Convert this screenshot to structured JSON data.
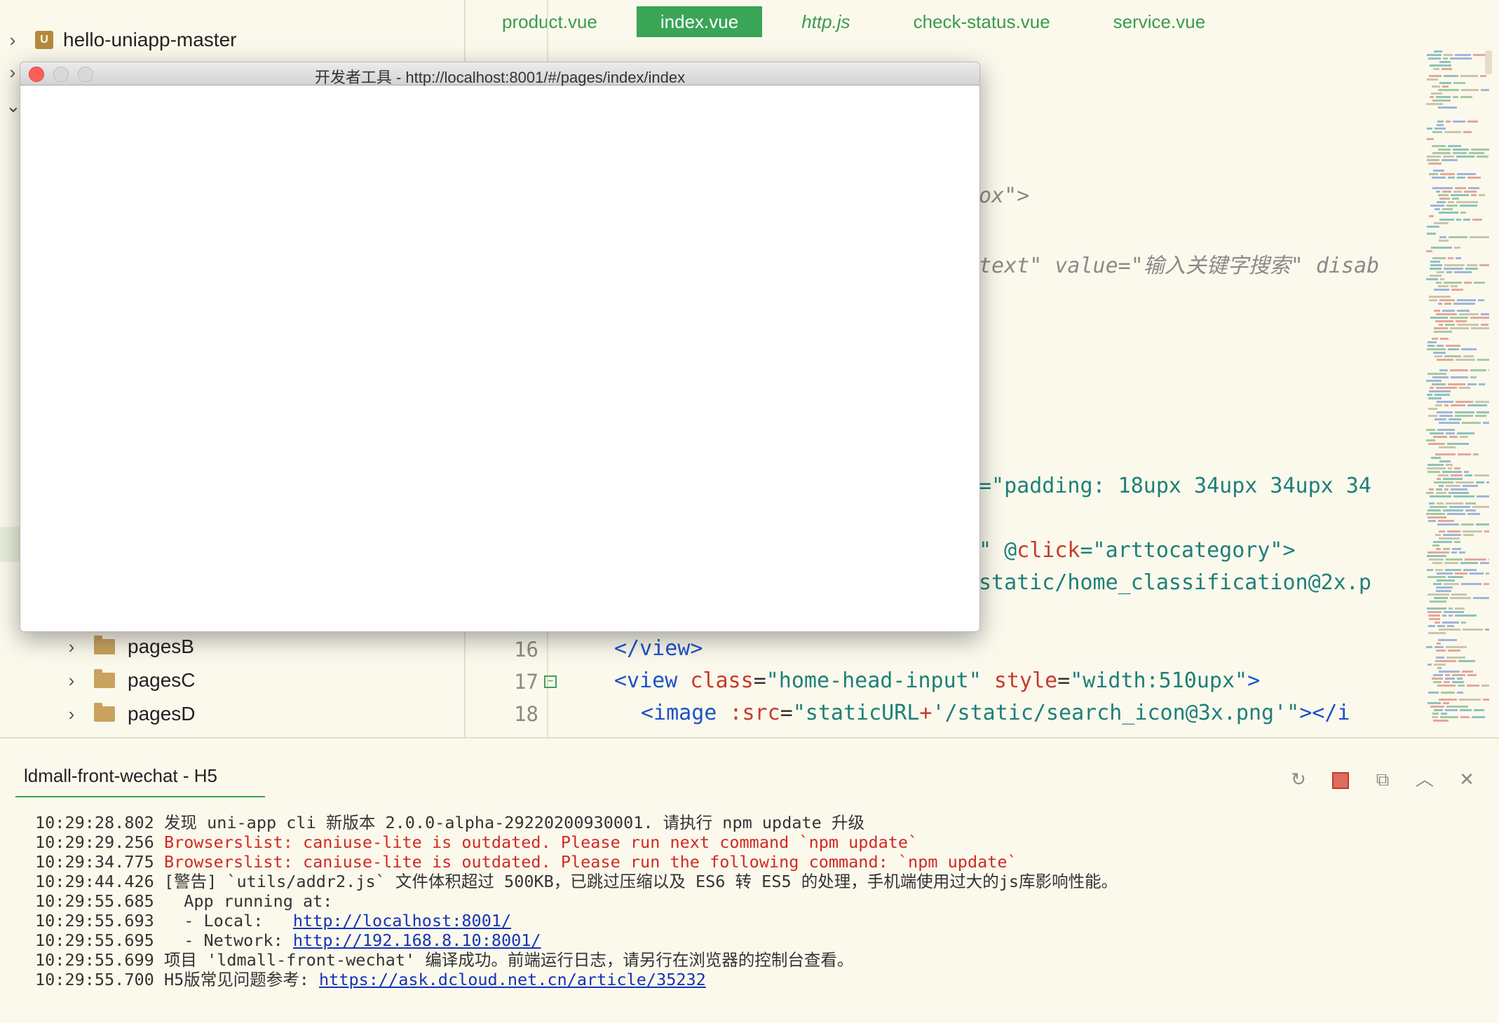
{
  "sidebar": {
    "project": "hello-uniapp-master",
    "folders": [
      "pagesB",
      "pagesC",
      "pagesD"
    ]
  },
  "editor": {
    "tabs": [
      {
        "label": "product.vue"
      },
      {
        "label": "index.vue"
      },
      {
        "label": "http.js"
      },
      {
        "label": "check-status.vue"
      },
      {
        "label": "service.vue"
      }
    ],
    "fragments": {
      "f1": "ox\">",
      "f2a": "text\" value=\"输入关键字搜索\" disab",
      "f3": "=\"padding: 18upx 34upx 34upx 34",
      "f4a": "\" @",
      "f4b": "click",
      "f4c": "=\"arttocategory\">",
      "f5": "static/home_classification@2x.p"
    },
    "lines": {
      "n16": "16",
      "n17": "17",
      "n18": "18",
      "l16": "</view>",
      "l17_tag": "<view",
      "l17_attr1": "class",
      "l17_eq1": "=",
      "l17_val1": "\"home-head-input\"",
      "l17_attr2": "style",
      "l17_eq2": "=",
      "l17_val2": "\"width:510upx\"",
      "l17_end": ">",
      "l18_tag": "<image",
      "l18_attr": ":src",
      "l18_eq": "=",
      "l18_val1": "\"staticURL",
      "l18_plus": "+",
      "l18_val2": "'/static/search_icon@3x.png'\"",
      "l18_end": "></i"
    }
  },
  "devtools": {
    "title": "开发者工具 - http://localhost:8001/#/pages/index/index"
  },
  "console": {
    "tab_label": "ldmall-front-wechat - H5",
    "logs": [
      {
        "time": "10:29:28.802",
        "msg": "发现 uni-app cli 新版本 2.0.0-alpha-29220200930001. 请执行 npm update 升级"
      },
      {
        "time": "10:29:29.256",
        "msg": "Browserslist: caniuse-lite is outdated. Please run next command `npm update`"
      },
      {
        "time": "10:29:34.775",
        "msg": "Browserslist: caniuse-lite is outdated. Please run the following command: `npm update`"
      },
      {
        "time": "10:29:44.426",
        "msg": "[警告] `utils/addr2.js` 文件体积超过 500KB，已跳过压缩以及 ES6 转 ES5 的处理，手机端使用过大的js库影响性能。"
      },
      {
        "time": "10:29:55.685",
        "msg": "  App running at:"
      },
      {
        "time": "10:29:55.693",
        "msg": "  - Local:   ",
        "link": "http://localhost:8001/"
      },
      {
        "time": "10:29:55.695",
        "msg": "  - Network: ",
        "link": "http://192.168.8.10:8001/"
      },
      {
        "time": "10:29:55.699",
        "msg": "项目 'ldmall-front-wechat' 编译成功。前端运行日志，请另行在浏览器的控制台查看。"
      },
      {
        "time": "10:29:55.700",
        "msg": "H5版常见问题参考: ",
        "link": "https://ask.dcloud.net.cn/article/35232"
      }
    ]
  },
  "colors": {
    "accent": "#3aa457",
    "error": "#d02a22",
    "link": "#1332b8",
    "background": "#fbf9ec"
  }
}
